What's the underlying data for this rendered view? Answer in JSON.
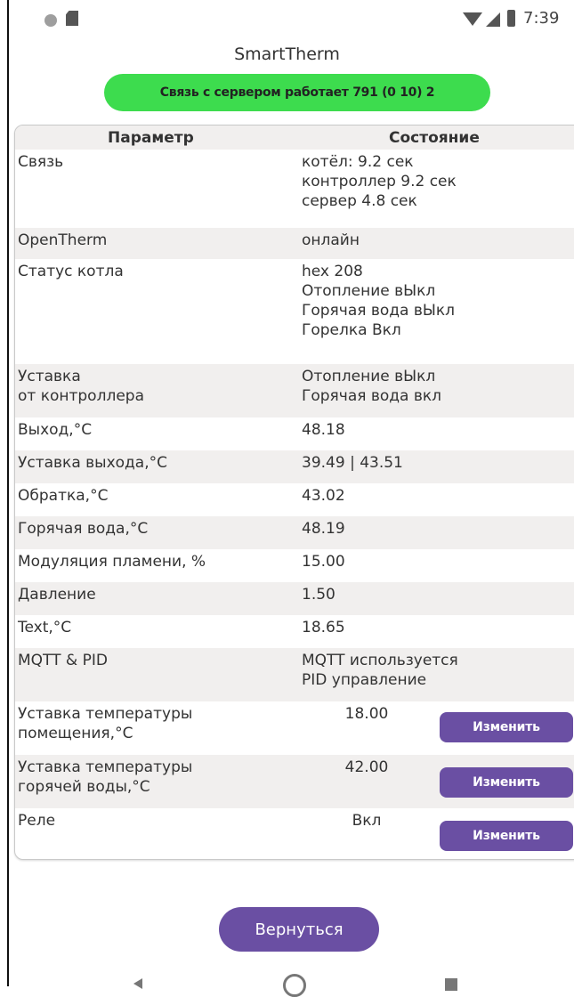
{
  "status_bar": {
    "time": "7:39",
    "icons": [
      "notification-dot-icon",
      "sd-card-icon",
      "wifi-icon",
      "cell-signal-icon",
      "battery-icon"
    ]
  },
  "app_title": "SmartTherm",
  "server_status": {
    "text": "Связь с сервером работает 791 (0 10) 2",
    "color": "#3ddc4e"
  },
  "table": {
    "headers": {
      "param": "Параметр",
      "state": "Состояние"
    },
    "rows": [
      {
        "param": "Связь",
        "state": "котёл: 9.2 сек\nконтроллер 9.2 сек\nсервер 4.8 сек"
      },
      {
        "param": "OpenTherm",
        "state": "онлайн"
      },
      {
        "param": "Статус котла",
        "state": "hex 208\nОтопление вЫкл\nГорячая вода вЫкл\nГорелка Вкл"
      },
      {
        "param": "Уставка\nот контроллера",
        "state": "Отопление вЫкл\nГорячая вода вкл"
      },
      {
        "param": "Выход,°C",
        "state": "48.18"
      },
      {
        "param": "Уставка выхода,°C",
        "state": "39.49 | 43.51"
      },
      {
        "param": "Обратка,°C",
        "state": "43.02"
      },
      {
        "param": "Горячая вода,°C",
        "state": "48.19"
      },
      {
        "param": "Модуляция пламени, %",
        "state": "15.00"
      },
      {
        "param": "Давление",
        "state": "1.50"
      },
      {
        "param": "Text,°C",
        "state": "18.65"
      },
      {
        "param": "MQTT & PID",
        "state": "MQTT используется\nPID управление"
      },
      {
        "param": "Уставка температуры\nпомещения,°C",
        "state": "18.00",
        "button": "Изменить"
      },
      {
        "param": "Уставка температуры\nгорячей воды,°C",
        "state": "42.00",
        "button": "Изменить"
      },
      {
        "param": "Реле",
        "state": "Вкл",
        "button": "Изменить"
      }
    ]
  },
  "back_button": "Вернуться",
  "accent_color": "#6a4fa3"
}
